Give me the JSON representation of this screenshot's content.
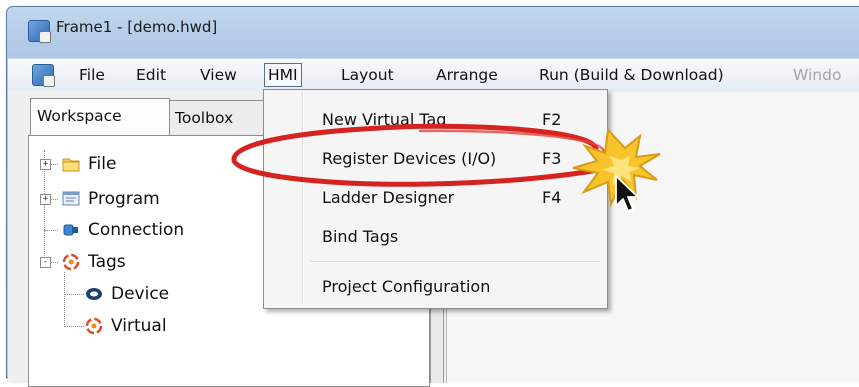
{
  "window": {
    "title": "Frame1 - [demo.hwd]"
  },
  "menubar": {
    "items": [
      {
        "label": "File"
      },
      {
        "label": "Edit"
      },
      {
        "label": "View"
      },
      {
        "label": "HMI",
        "state": "open"
      },
      {
        "label": "Layout"
      },
      {
        "label": "Arrange"
      },
      {
        "label": "Run (Build & Download)"
      },
      {
        "label": "Windo",
        "state": "disabled"
      }
    ]
  },
  "tabs": [
    {
      "label": "Workspace",
      "selected": true
    },
    {
      "label": "Toolbox"
    }
  ],
  "tree": [
    {
      "label": "File",
      "icon": "folder-icon",
      "expander": "+"
    },
    {
      "label": "Program",
      "icon": "program-icon",
      "expander": "+"
    },
    {
      "label": "Connection",
      "icon": "connection-icon"
    },
    {
      "label": "Tags",
      "icon": "tags-icon",
      "expander": "-"
    },
    {
      "label": "Device",
      "icon": "device-icon"
    },
    {
      "label": "Virtual",
      "icon": "virtual-icon"
    }
  ],
  "hmi_menu": {
    "items": [
      {
        "label": "New Virtual Tag",
        "shortcut": "F2",
        "underline": "V"
      },
      {
        "label": "Register Devices (I/O)",
        "shortcut": "F3",
        "highlighted_by_annotation": true
      },
      {
        "label": "Ladder Designer",
        "shortcut": "F4"
      },
      {
        "label": "Bind Tags",
        "shortcut": ""
      },
      {
        "label": "Project Configuration",
        "shortcut": ""
      }
    ]
  },
  "colors": {
    "annotation_red": "#d42320",
    "burst_yellow": "#f7c52b",
    "menu_border": "#5a6f8d",
    "title_blue": "#a9c3e3"
  }
}
